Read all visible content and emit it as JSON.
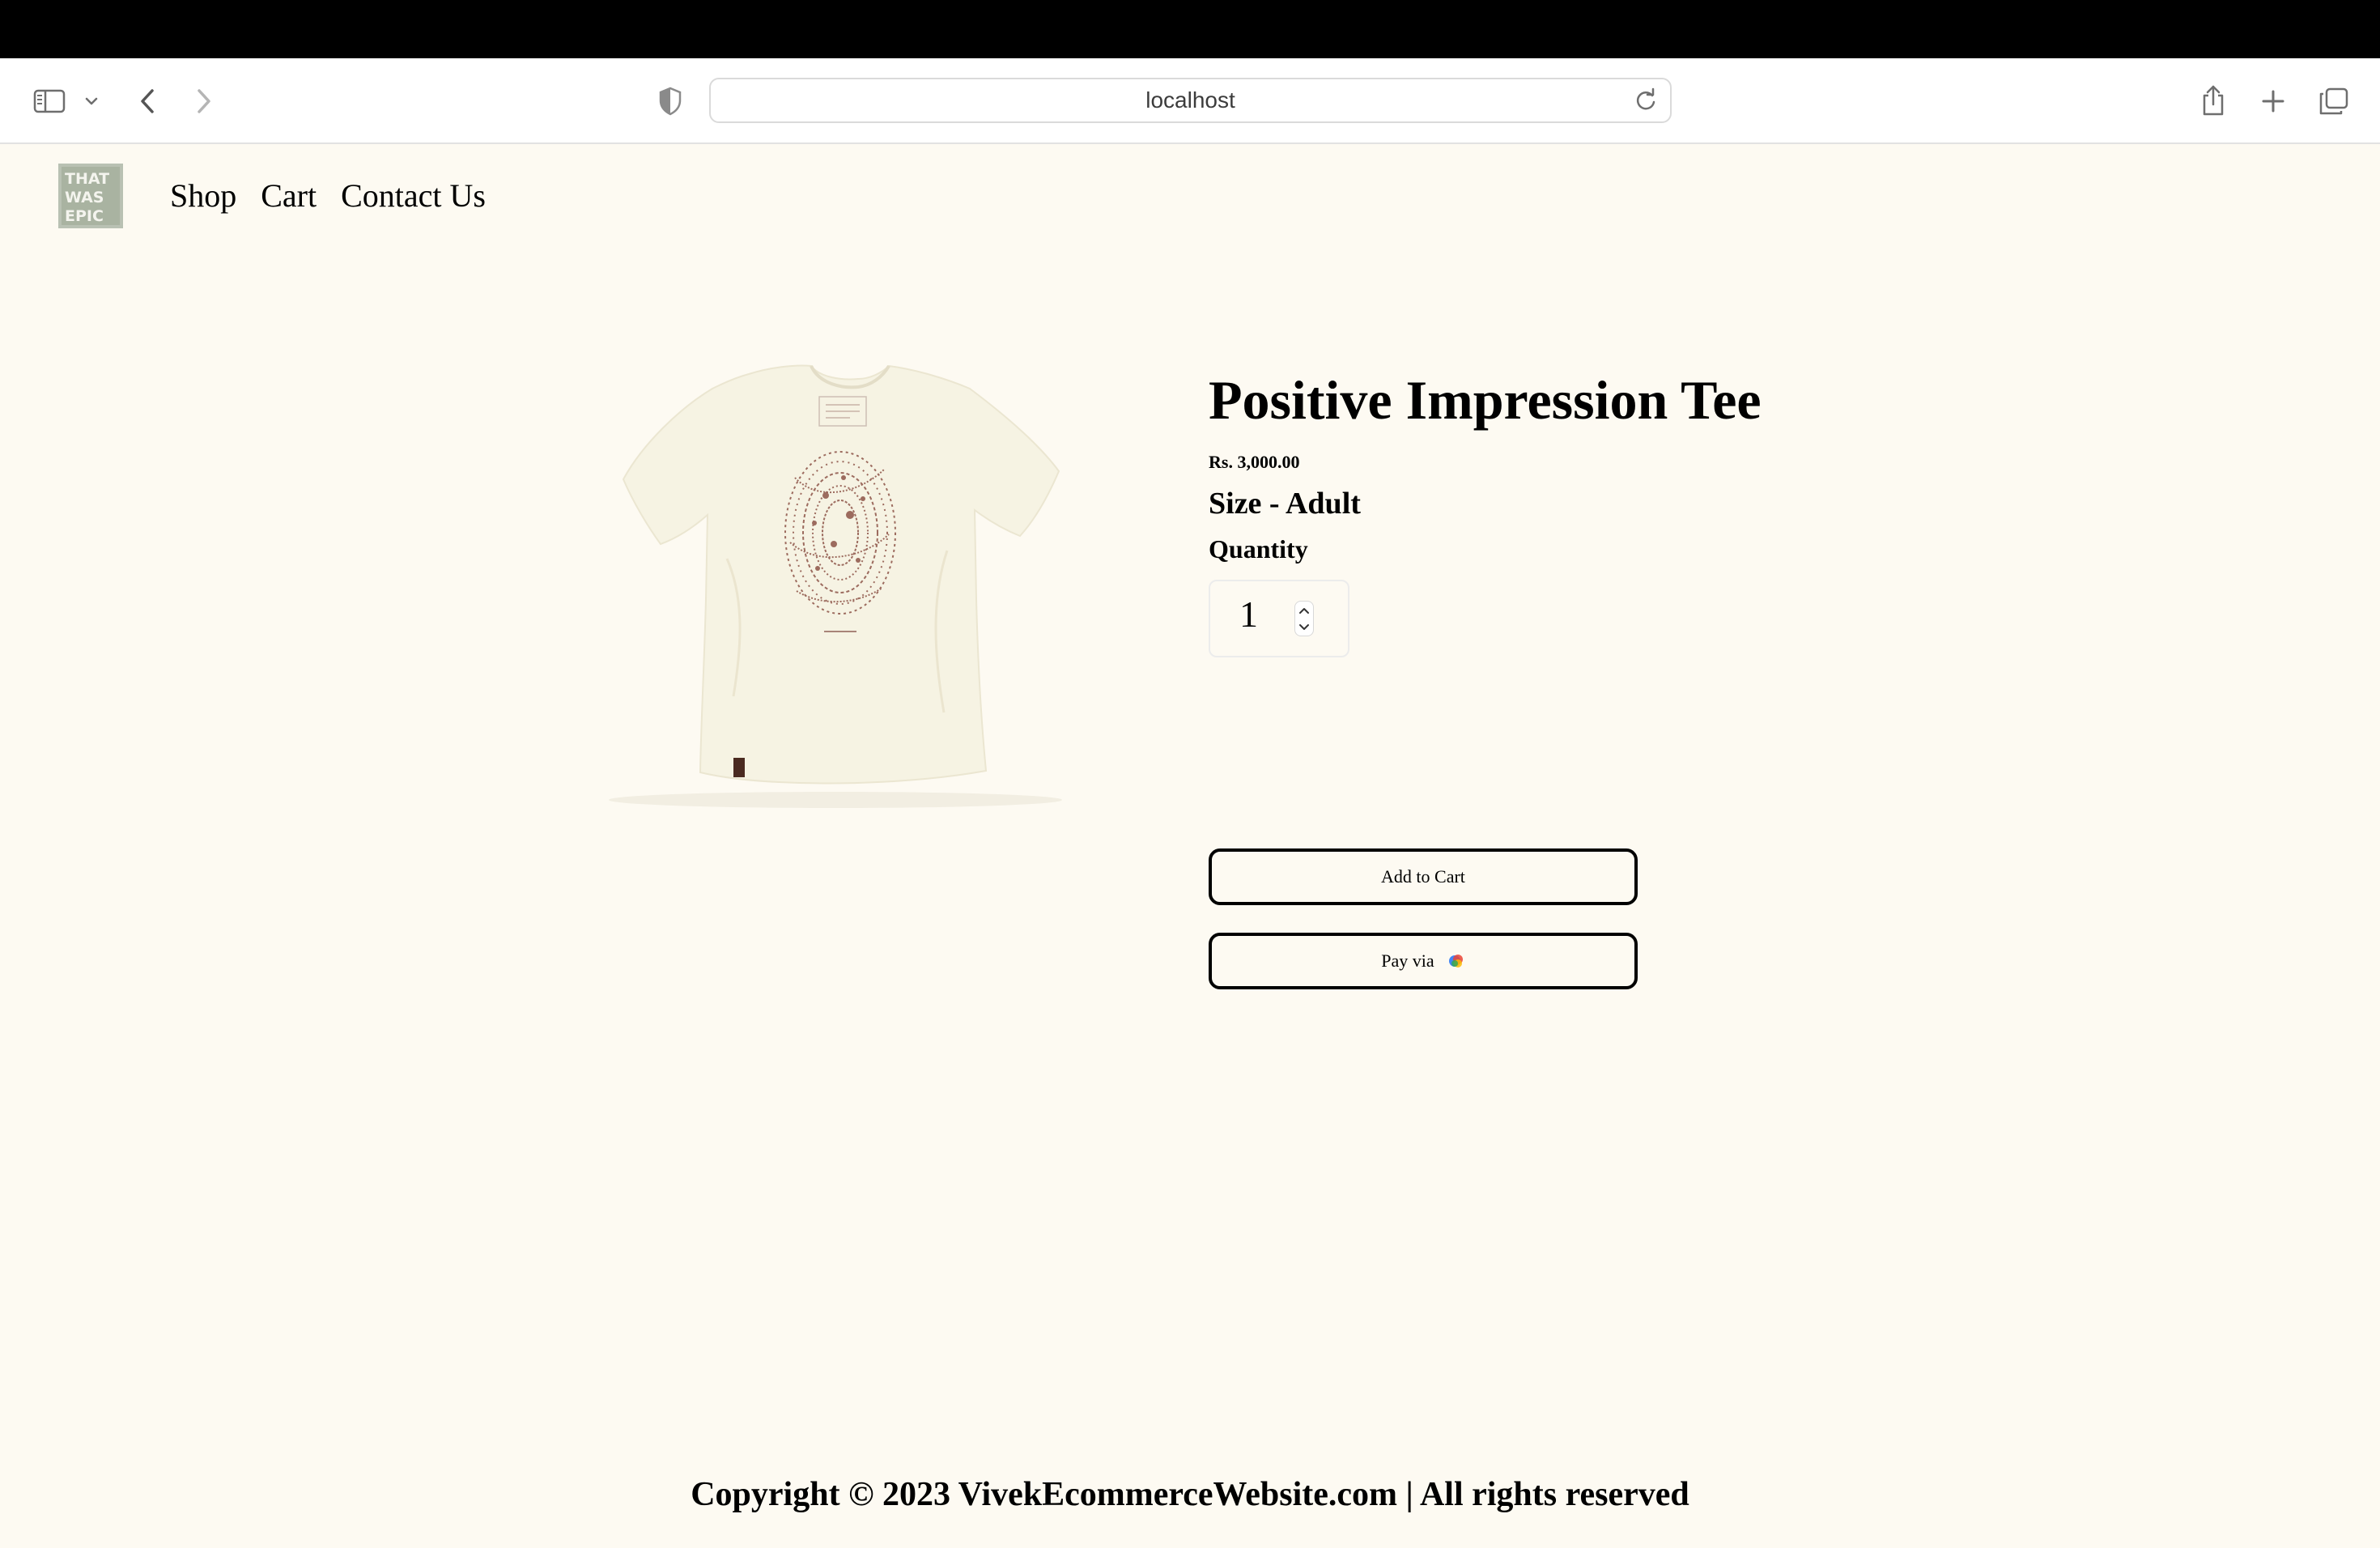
{
  "browser": {
    "url": "localhost"
  },
  "site": {
    "logo_text": "THAT WAS EPIC",
    "nav": [
      "Shop",
      "Cart",
      "Contact Us"
    ]
  },
  "product": {
    "title": "Positive Impression Tee",
    "price": "Rs. 3,000.00",
    "size": "Size - Adult",
    "quantity_label": "Quantity",
    "quantity_value": "1",
    "add_to_cart_label": "Add to Cart",
    "pay_label": "Pay via"
  },
  "footer": {
    "copyright": "Copyright © 2023 VivekEcommerceWebsite.com | All rights reserved"
  },
  "colors": {
    "page_background": "#fdfaf2",
    "shirt": "#f6f3e3",
    "print": "#9c6b5e",
    "button_border": "#000000"
  }
}
